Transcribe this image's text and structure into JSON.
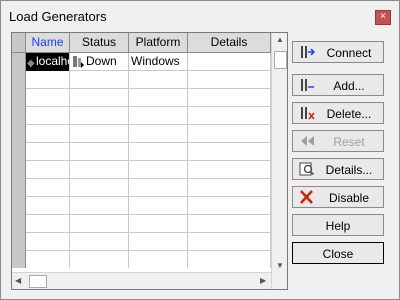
{
  "window": {
    "title": "Load Generators",
    "close_glyph": "×"
  },
  "grid": {
    "columns": [
      "Name",
      "Status",
      "Platform",
      "Details"
    ],
    "rows": [
      {
        "name": "localhost",
        "status": "Down",
        "platform": "Windows",
        "details": ""
      }
    ]
  },
  "buttons": {
    "connect": "Connect",
    "add": "Add...",
    "delete": "Delete...",
    "reset": "Reset",
    "details": "Details...",
    "disable": "Disable",
    "help": "Help",
    "close": "Close"
  },
  "colors": {
    "name_header": "#1a3cff",
    "selected_bg": "#000000",
    "disable_icon": "#cc2200"
  }
}
